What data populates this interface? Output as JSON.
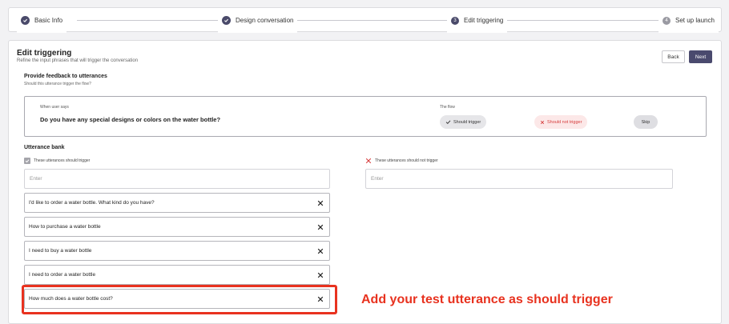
{
  "stepper": {
    "steps": [
      {
        "label": "Basic Info",
        "state": "complete"
      },
      {
        "label": "Design conversation",
        "state": "complete"
      },
      {
        "label": "Edit triggering",
        "state": "active",
        "number": "3"
      },
      {
        "label": "Set up launch",
        "state": "inactive",
        "number": "4"
      }
    ]
  },
  "header": {
    "title": "Edit triggering",
    "subtitle": "Refine the input phrases that will trigger the conversation",
    "back_label": "Back",
    "next_label": "Next"
  },
  "feedback": {
    "title": "Provide feedback to utterances",
    "subtitle": "Should this utterance trigger the flow?",
    "when_user_says_label": "When user says",
    "utterance": "Do you have any special designs or colors on the water bottle?",
    "the_flow_label": "The flow",
    "should_trigger_label": "Should trigger",
    "should_not_trigger_label": "Should not trigger",
    "skip_label": "Skip"
  },
  "bank": {
    "title": "Utterance bank",
    "should_label": "These utterances should trigger",
    "should_not_label": "These utterances should not trigger",
    "should_placeholder": "Enter",
    "should_not_placeholder": "Enter",
    "should_items": [
      "I'd like to order a water bottle. What kind do you have?",
      "How to purchase a water bottle",
      "I need to buy a water bottle",
      "I need to order a water bottle",
      "How much does a water bottle cost?"
    ]
  },
  "annotation": {
    "callout": "Add your test utterance as should trigger"
  },
  "colors": {
    "primary": "#4a4a6e",
    "annotation": "#e8321f",
    "danger": "#d63b3b"
  }
}
